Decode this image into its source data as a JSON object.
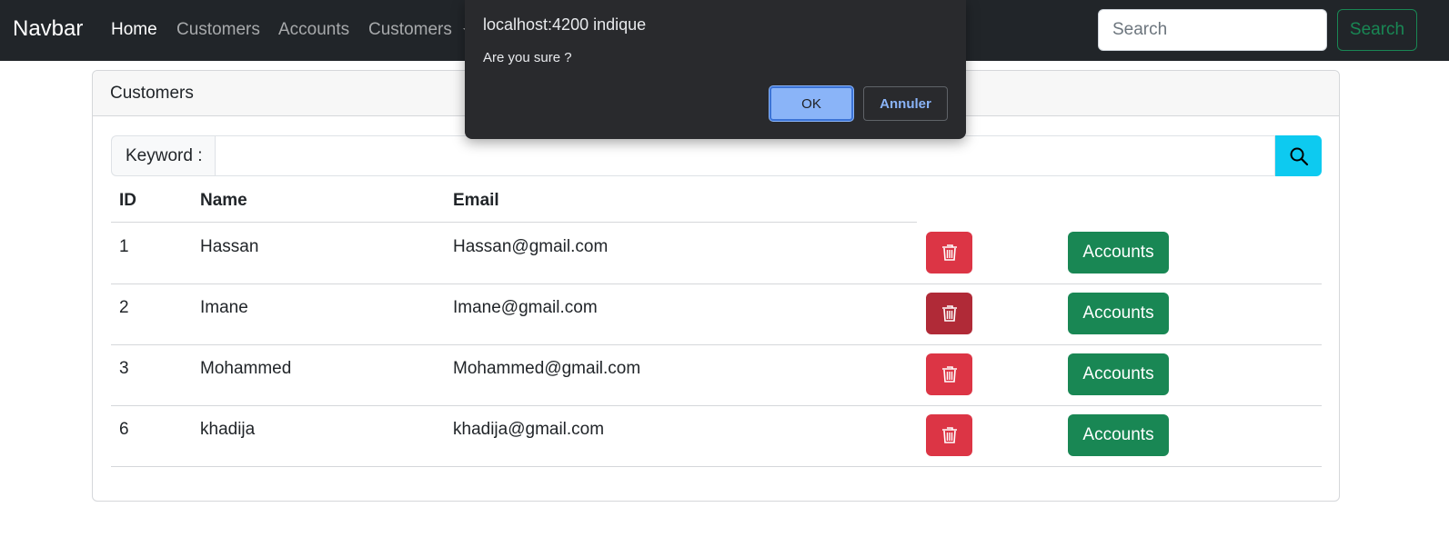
{
  "navbar": {
    "brand": "Navbar",
    "links": [
      "Home",
      "Customers",
      "Accounts",
      "Customers"
    ],
    "search_placeholder": "Search",
    "search_button": "Search"
  },
  "card": {
    "title": "Customers",
    "keyword_label": "Keyword :",
    "table": {
      "headers": [
        "ID",
        "Name",
        "Email"
      ],
      "rows": [
        {
          "id": "1",
          "name": "Hassan",
          "email": "Hassan@gmail.com"
        },
        {
          "id": "2",
          "name": "Imane",
          "email": "Imane@gmail.com"
        },
        {
          "id": "3",
          "name": "Mohammed",
          "email": "Mohammed@gmail.com"
        },
        {
          "id": "6",
          "name": "khadija",
          "email": "khadija@gmail.com"
        }
      ],
      "accounts_label": "Accounts"
    }
  },
  "dialog": {
    "title": "localhost:4200 indique",
    "message": "Are you sure ?",
    "ok_label": "OK",
    "cancel_label": "Annuler"
  },
  "colors": {
    "navbar_bg": "#212529",
    "danger": "#dc3545",
    "success": "#198754",
    "info": "#0dcaf0",
    "dialog_bg": "#292a2d",
    "dialog_accent": "#8ab4f8"
  },
  "icons": [
    "search-icon",
    "trash-icon",
    "chevron-down-icon"
  ]
}
